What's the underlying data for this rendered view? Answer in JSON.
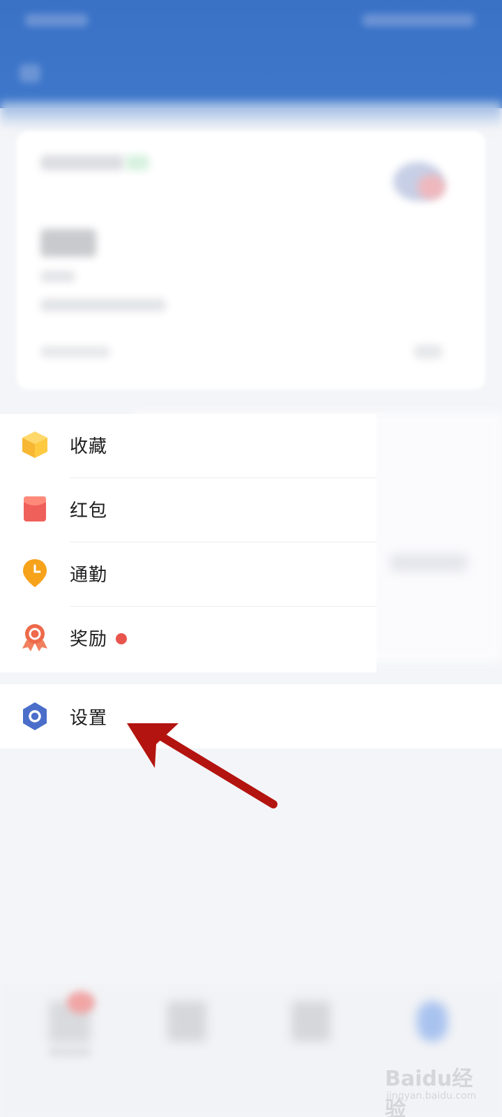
{
  "menu": {
    "items": [
      {
        "label": "收藏",
        "icon": "cube-icon"
      },
      {
        "label": "红包",
        "icon": "red-envelope-icon"
      },
      {
        "label": "通勤",
        "icon": "location-clock-icon"
      },
      {
        "label": "奖励",
        "icon": "award-ribbon-icon",
        "badge": true
      }
    ]
  },
  "settings": {
    "label": "设置",
    "icon": "hexagon-settings-icon"
  },
  "watermark": {
    "main": "Baidu经验",
    "sub": "jingyan.baidu.com"
  },
  "colors": {
    "header_blue": "#3a72c6",
    "badge_red": "#e8554c",
    "arrow_red": "#b3140f",
    "settings_blue": "#4a6ec9"
  }
}
